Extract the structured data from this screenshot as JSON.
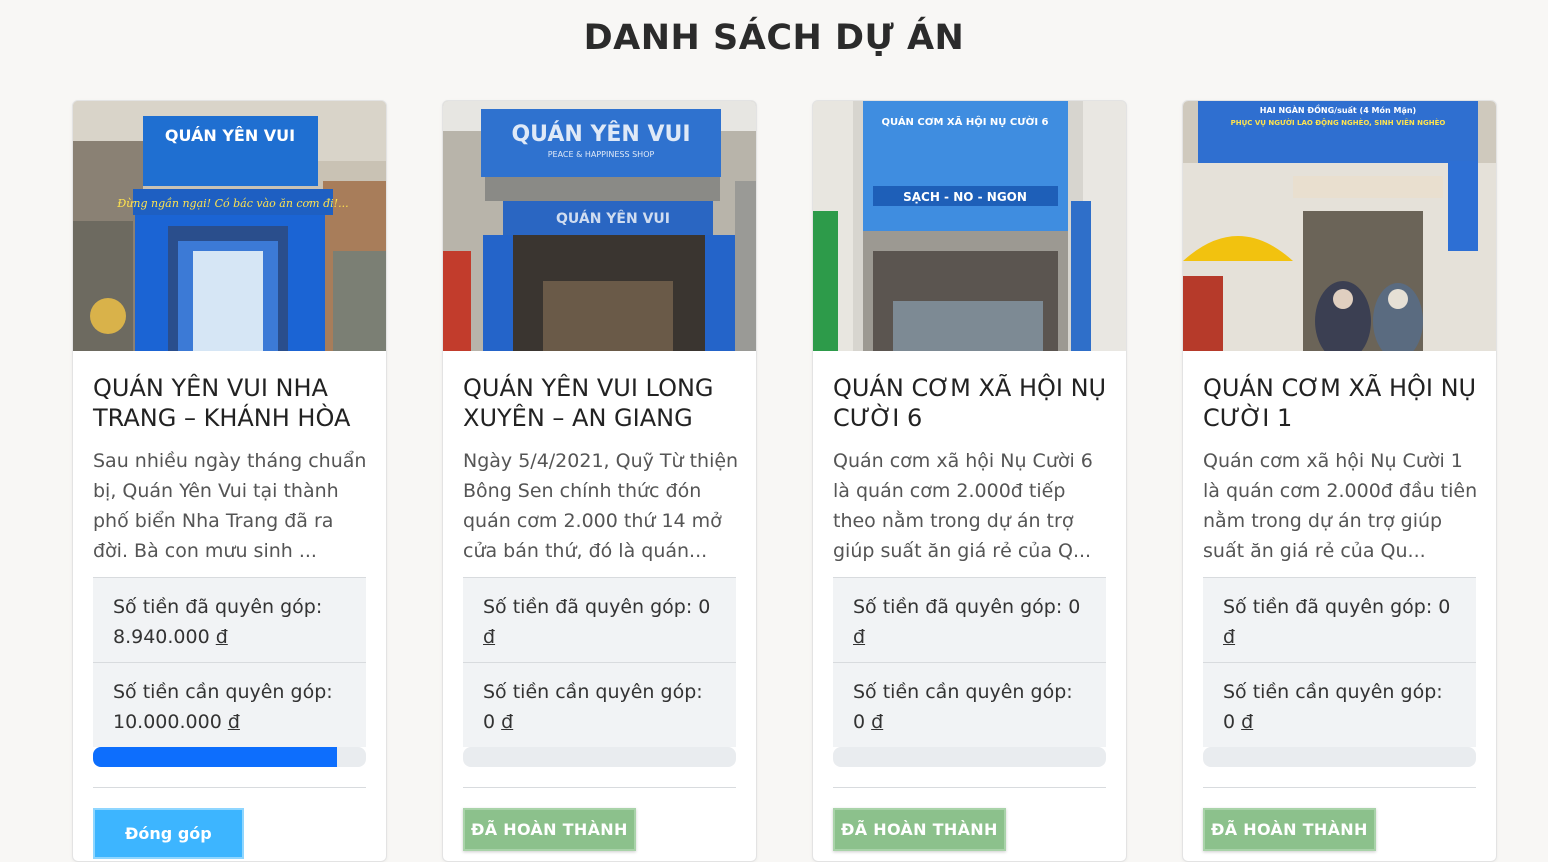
{
  "page": {
    "title": "DANH SÁCH DỰ ÁN"
  },
  "cards": [
    {
      "sign_text": "QUÁN YÊN VUI",
      "banner_text": "Đừng ngần ngại! Có bác vào ăn cơm đi!...",
      "title": "QUÁN YÊN VUI NHA TRANG – KHÁNH HÒA",
      "description": "Sau nhiều ngày tháng chuẩn bị, Quán Yên Vui tại thành phố biển Nha Trang đã ra đời. Bà con mưu sinh ...",
      "donated_label": "Số tiền đã quyên góp:",
      "donated_value": "8.940.000",
      "needed_label": "Số tiền cần quyên góp:",
      "needed_value": "10.000.000",
      "currency": "đ",
      "progress": 0.894,
      "button_label": "Đóng góp"
    },
    {
      "sign_text": "QUÁN YÊN VUI",
      "sign_sub": "PEACE & HAPPINESS SHOP",
      "title": "QUÁN YÊN VUI LONG XUYÊN – AN GIANG",
      "description": "Ngày 5/4/2021, Quỹ Từ thiện Bông Sen chính thức đón quán cơm 2.000 thứ 14 mở cửa bán thứ, đó là quán...",
      "donated_label": "Số tiền đã quyên góp:",
      "donated_value": "0",
      "needed_label": "Số tiền cần quyên góp:",
      "needed_value": "0",
      "currency": "đ",
      "progress": 0,
      "button_label": "ĐÃ HOÀN THÀNH"
    },
    {
      "sign_text": "QUÁN CƠM XÃ HỘI NỤ CƯỜI 6",
      "sign_sub": "SẠCH - NO - NGON",
      "title": "QUÁN CƠM XÃ HỘI NỤ CƯỜI 6",
      "description": "Quán cơm xã hội Nụ Cười 6 là quán cơm 2.000đ tiếp theo nằm trong dự án trợ giúp suất ăn giá rẻ của Q...",
      "donated_label": "Số tiền đã quyên góp:",
      "donated_value": "0",
      "needed_label": "Số tiền cần quyên góp:",
      "needed_value": "0",
      "currency": "đ",
      "progress": 0,
      "button_label": "ĐÃ HOÀN THÀNH"
    },
    {
      "sign_text": "HAI NGÀN ĐỒNG/suất (4 Món Mặn)",
      "sign_sub": "PHỤC VỤ NGƯỜI LAO ĐỘNG NGHÈO, SINH VIÊN NGHÈO",
      "title": "QUÁN CƠM XÃ HỘI NỤ CƯỜI 1",
      "description": "Quán cơm xã hội Nụ Cười 1 là quán cơm 2.000đ đầu tiên nằm trong dự án trợ giúp suất ăn giá rẻ của Qu...",
      "donated_label": "Số tiền đã quyên góp:",
      "donated_value": "0",
      "needed_label": "Số tiền cần quyên góp:",
      "needed_value": "0",
      "currency": "đ",
      "progress": 0,
      "button_label": "ĐÃ HOÀN THÀNH"
    }
  ],
  "colors": {
    "background": "#f8f7f5",
    "progress_fill": "#0d6efd",
    "done_button": "#8cc18c",
    "donate_button": "#3db5ff"
  }
}
